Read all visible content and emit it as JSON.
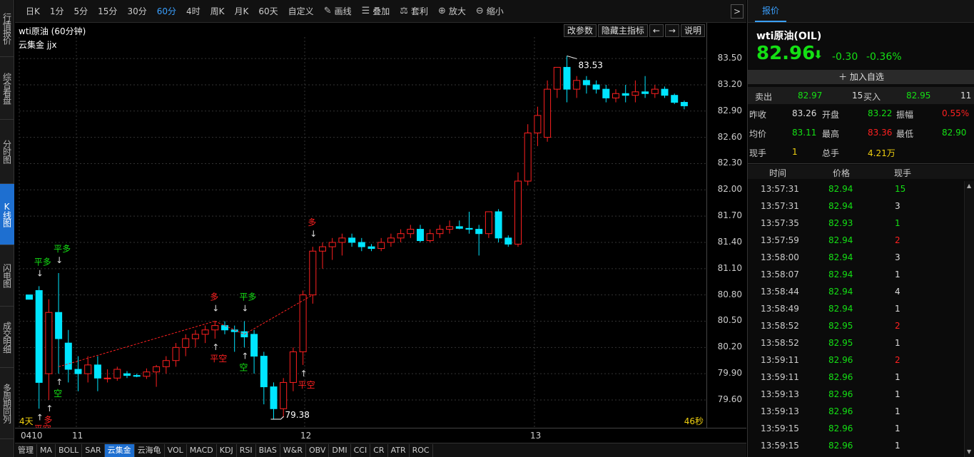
{
  "left_tabs": [
    "行情报价",
    "综合看盘",
    "分时图",
    "K线图",
    "闪电图",
    "成交明细",
    "多周期同列"
  ],
  "toolbar": {
    "periods": [
      "日K",
      "1分",
      "5分",
      "15分",
      "30分",
      "60分",
      "4时",
      "周K",
      "月K",
      "60天",
      "自定义"
    ],
    "active_period": "60分",
    "tools": [
      {
        "icon": "pencil-icon",
        "label": "画线"
      },
      {
        "icon": "layers-icon",
        "label": "叠加"
      },
      {
        "icon": "arbitrage-icon",
        "label": "套利"
      },
      {
        "icon": "zoom-in-icon",
        "label": "放大"
      },
      {
        "icon": "zoom-out-icon",
        "label": "缩小"
      }
    ],
    "expand": ">"
  },
  "chart": {
    "title": "wti原油 (60分钟)",
    "indicator": "云集金 jjx",
    "buttons": [
      "改参数",
      "隐藏主指标",
      "←",
      "→",
      "说明"
    ],
    "days_left": "4天",
    "seconds_left": "46秒",
    "high_label": "83.53",
    "low_label": "79.38",
    "date_labels": [
      "0410",
      "11",
      "12",
      "13"
    ]
  },
  "chart_data": {
    "type": "candlestick",
    "ylim": [
      79.38,
      83.55
    ],
    "y_ticks": [
      "83.50",
      "83.20",
      "82.90",
      "82.60",
      "82.30",
      "82.00",
      "81.70",
      "81.40",
      "81.10",
      "80.80",
      "80.50",
      "80.20",
      "79.90",
      "79.60"
    ],
    "candles": [
      {
        "o": 80.8,
        "h": 80.8,
        "l": 80.75,
        "c": 80.75
      },
      {
        "o": 80.85,
        "h": 80.9,
        "l": 79.5,
        "c": 79.8
      },
      {
        "o": 79.9,
        "h": 80.75,
        "l": 79.6,
        "c": 80.6
      },
      {
        "o": 80.6,
        "h": 81.05,
        "l": 79.9,
        "c": 80.3
      },
      {
        "o": 80.25,
        "h": 80.4,
        "l": 79.8,
        "c": 79.95
      },
      {
        "o": 79.95,
        "h": 80.1,
        "l": 79.7,
        "c": 79.9
      },
      {
        "o": 79.9,
        "h": 80.1,
        "l": 79.8,
        "c": 80.0
      },
      {
        "o": 80.0,
        "h": 80.1,
        "l": 79.7,
        "c": 79.85
      },
      {
        "o": 79.85,
        "h": 79.95,
        "l": 79.8,
        "c": 79.85
      },
      {
        "o": 79.85,
        "h": 79.98,
        "l": 79.82,
        "c": 79.95
      },
      {
        "o": 79.9,
        "h": 79.93,
        "l": 79.85,
        "c": 79.88
      },
      {
        "o": 79.88,
        "h": 79.9,
        "l": 79.86,
        "c": 79.87
      },
      {
        "o": 79.87,
        "h": 79.96,
        "l": 79.84,
        "c": 79.92
      },
      {
        "o": 79.92,
        "h": 80.0,
        "l": 79.75,
        "c": 79.98
      },
      {
        "o": 79.98,
        "h": 80.1,
        "l": 79.9,
        "c": 80.05
      },
      {
        "o": 80.05,
        "h": 80.25,
        "l": 79.98,
        "c": 80.2
      },
      {
        "o": 80.2,
        "h": 80.35,
        "l": 80.1,
        "c": 80.3
      },
      {
        "o": 80.3,
        "h": 80.4,
        "l": 80.2,
        "c": 80.35
      },
      {
        "o": 80.35,
        "h": 80.45,
        "l": 80.25,
        "c": 80.4
      },
      {
        "o": 80.4,
        "h": 80.5,
        "l": 80.3,
        "c": 80.45
      },
      {
        "o": 80.45,
        "h": 80.5,
        "l": 80.35,
        "c": 80.4
      },
      {
        "o": 80.4,
        "h": 80.45,
        "l": 80.15,
        "c": 80.38
      },
      {
        "o": 80.38,
        "h": 80.5,
        "l": 80.2,
        "c": 80.32
      },
      {
        "o": 80.35,
        "h": 80.4,
        "l": 79.9,
        "c": 80.1
      },
      {
        "o": 80.1,
        "h": 80.15,
        "l": 79.55,
        "c": 79.75
      },
      {
        "o": 79.75,
        "h": 79.8,
        "l": 79.38,
        "c": 79.5
      },
      {
        "o": 79.5,
        "h": 79.85,
        "l": 79.4,
        "c": 79.8
      },
      {
        "o": 79.8,
        "h": 80.2,
        "l": 79.7,
        "c": 80.15
      },
      {
        "o": 80.15,
        "h": 80.85,
        "l": 80.0,
        "c": 80.8
      },
      {
        "o": 80.8,
        "h": 81.35,
        "l": 80.7,
        "c": 81.3
      },
      {
        "o": 81.3,
        "h": 81.4,
        "l": 81.1,
        "c": 81.35
      },
      {
        "o": 81.35,
        "h": 81.45,
        "l": 81.2,
        "c": 81.4
      },
      {
        "o": 81.4,
        "h": 81.5,
        "l": 81.25,
        "c": 81.45
      },
      {
        "o": 81.45,
        "h": 81.5,
        "l": 81.35,
        "c": 81.4
      },
      {
        "o": 81.4,
        "h": 81.45,
        "l": 81.3,
        "c": 81.35
      },
      {
        "o": 81.35,
        "h": 81.38,
        "l": 81.3,
        "c": 81.33
      },
      {
        "o": 81.33,
        "h": 81.45,
        "l": 81.3,
        "c": 81.4
      },
      {
        "o": 81.4,
        "h": 81.5,
        "l": 81.35,
        "c": 81.45
      },
      {
        "o": 81.45,
        "h": 81.55,
        "l": 81.4,
        "c": 81.5
      },
      {
        "o": 81.5,
        "h": 81.6,
        "l": 81.45,
        "c": 81.55
      },
      {
        "o": 81.55,
        "h": 81.6,
        "l": 81.4,
        "c": 81.42
      },
      {
        "o": 81.42,
        "h": 81.55,
        "l": 81.4,
        "c": 81.5
      },
      {
        "o": 81.5,
        "h": 81.6,
        "l": 81.45,
        "c": 81.55
      },
      {
        "o": 81.55,
        "h": 81.65,
        "l": 81.5,
        "c": 81.58
      },
      {
        "o": 81.58,
        "h": 81.65,
        "l": 81.55,
        "c": 81.56
      },
      {
        "o": 81.56,
        "h": 81.75,
        "l": 81.5,
        "c": 81.55
      },
      {
        "o": 81.55,
        "h": 81.6,
        "l": 81.25,
        "c": 81.5
      },
      {
        "o": 81.5,
        "h": 81.75,
        "l": 81.45,
        "c": 81.75
      },
      {
        "o": 81.75,
        "h": 81.78,
        "l": 81.4,
        "c": 81.45
      },
      {
        "o": 81.45,
        "h": 81.48,
        "l": 81.35,
        "c": 81.38
      },
      {
        "o": 81.38,
        "h": 82.2,
        "l": 81.35,
        "c": 82.1
      },
      {
        "o": 82.1,
        "h": 82.75,
        "l": 82.05,
        "c": 82.65
      },
      {
        "o": 82.65,
        "h": 82.95,
        "l": 82.5,
        "c": 82.85
      },
      {
        "o": 82.6,
        "h": 83.25,
        "l": 82.55,
        "c": 83.15
      },
      {
        "o": 83.15,
        "h": 83.4,
        "l": 83.05,
        "c": 83.4
      },
      {
        "o": 83.4,
        "h": 83.53,
        "l": 83.0,
        "c": 83.15
      },
      {
        "o": 83.15,
        "h": 83.3,
        "l": 83.05,
        "c": 83.25
      },
      {
        "o": 83.25,
        "h": 83.3,
        "l": 83.1,
        "c": 83.2
      },
      {
        "o": 83.2,
        "h": 83.25,
        "l": 83.1,
        "c": 83.15
      },
      {
        "o": 83.15,
        "h": 83.2,
        "l": 83.0,
        "c": 83.05
      },
      {
        "o": 83.05,
        "h": 83.15,
        "l": 83.0,
        "c": 83.1
      },
      {
        "o": 83.1,
        "h": 83.2,
        "l": 83.0,
        "c": 83.08
      },
      {
        "o": 83.08,
        "h": 83.25,
        "l": 83.0,
        "c": 83.12
      },
      {
        "o": 83.12,
        "h": 83.3,
        "l": 83.05,
        "c": 83.1
      },
      {
        "o": 83.1,
        "h": 83.2,
        "l": 83.05,
        "c": 83.15
      },
      {
        "o": 83.15,
        "h": 83.18,
        "l": 83.05,
        "c": 83.08
      },
      {
        "o": 83.08,
        "h": 83.1,
        "l": 82.98,
        "c": 83.0
      },
      {
        "o": 83.0,
        "h": 83.02,
        "l": 82.92,
        "c": 82.96
      }
    ],
    "signals": [
      {
        "label": "平多",
        "color": "#14e014",
        "candle": 1,
        "pos": "above"
      },
      {
        "label": "平空",
        "color": "#ff2020",
        "candle": 1,
        "pos": "below"
      },
      {
        "label": "空",
        "color": "#14e014",
        "candle": 1,
        "pos": "below2"
      },
      {
        "label": "多",
        "color": "#ff2020",
        "candle": 2,
        "pos": "below"
      },
      {
        "label": "平多",
        "color": "#14e014",
        "candle": 3,
        "pos": "above"
      },
      {
        "label": "空",
        "color": "#14e014",
        "candle": 3,
        "pos": "below"
      },
      {
        "label": "多",
        "color": "#ff2020",
        "candle": 19,
        "pos": "above"
      },
      {
        "label": "平空",
        "color": "#ff2020",
        "candle": 19,
        "pos": "below"
      },
      {
        "label": "平多",
        "color": "#14e014",
        "candle": 22,
        "pos": "above"
      },
      {
        "label": "空",
        "color": "#14e014",
        "candle": 22,
        "pos": "below"
      },
      {
        "label": "平空",
        "color": "#ff2020",
        "candle": 28,
        "pos": "below"
      },
      {
        "label": "多",
        "color": "#ff2020",
        "candle": 29,
        "pos": "above"
      }
    ]
  },
  "bottom_tabs": [
    "管理",
    "MA",
    "BOLL",
    "SAR",
    "云集金",
    "云海龟",
    "VOL",
    "MACD",
    "KDJ",
    "RSI",
    "BIAS",
    "W&R",
    "OBV",
    "DMI",
    "CCI",
    "CR",
    "ATR",
    "ROC"
  ],
  "active_bottom_tab": "云集金",
  "quote": {
    "tab": "报价",
    "name": "wti原油(OIL)",
    "price": "82.96",
    "change": "-0.30",
    "pct": "-0.36%",
    "add_watch": "加入自选",
    "sell_label": "卖出",
    "sell_price": "82.97",
    "sell_vol": "15",
    "buy_label": "买入",
    "buy_price": "82.95",
    "buy_vol": "11",
    "stats": [
      {
        "label": "昨收",
        "value": "83.26",
        "color": "#ddd"
      },
      {
        "label": "开盘",
        "value": "83.22",
        "color": "#14e014"
      },
      {
        "label": "振幅",
        "value": "0.55%",
        "color": "#ff2020"
      },
      {
        "label": "均价",
        "value": "83.11",
        "color": "#14e014"
      },
      {
        "label": "最高",
        "value": "83.36",
        "color": "#ff2020"
      },
      {
        "label": "最低",
        "value": "82.90",
        "color": "#14e014"
      },
      {
        "label": "现手",
        "value": "1",
        "color": "#f0d010"
      },
      {
        "label": "总手",
        "value": "4.21万",
        "color": "#f0d010"
      }
    ],
    "tick_headers": [
      "时间",
      "价格",
      "现手"
    ],
    "ticks": [
      {
        "time": "13:57:31",
        "price": "82.94",
        "vol": "15",
        "vcolor": "#14e014"
      },
      {
        "time": "13:57:31",
        "price": "82.94",
        "vol": "3",
        "vcolor": "#ddd"
      },
      {
        "time": "13:57:35",
        "price": "82.93",
        "vol": "1",
        "vcolor": "#14e014"
      },
      {
        "time": "13:57:59",
        "price": "82.94",
        "vol": "2",
        "vcolor": "#ff2020"
      },
      {
        "time": "13:58:00",
        "price": "82.94",
        "vol": "3",
        "vcolor": "#ddd"
      },
      {
        "time": "13:58:07",
        "price": "82.94",
        "vol": "1",
        "vcolor": "#ddd"
      },
      {
        "time": "13:58:44",
        "price": "82.94",
        "vol": "4",
        "vcolor": "#ddd"
      },
      {
        "time": "13:58:49",
        "price": "82.94",
        "vol": "1",
        "vcolor": "#ddd"
      },
      {
        "time": "13:58:52",
        "price": "82.95",
        "vol": "2",
        "vcolor": "#ff2020"
      },
      {
        "time": "13:58:52",
        "price": "82.95",
        "vol": "1",
        "vcolor": "#ddd"
      },
      {
        "time": "13:59:11",
        "price": "82.96",
        "vol": "2",
        "vcolor": "#ff2020"
      },
      {
        "time": "13:59:11",
        "price": "82.96",
        "vol": "1",
        "vcolor": "#ddd"
      },
      {
        "time": "13:59:13",
        "price": "82.96",
        "vol": "1",
        "vcolor": "#ddd"
      },
      {
        "time": "13:59:13",
        "price": "82.96",
        "vol": "1",
        "vcolor": "#ddd"
      },
      {
        "time": "13:59:15",
        "price": "82.96",
        "vol": "1",
        "vcolor": "#ddd"
      },
      {
        "time": "13:59:15",
        "price": "82.96",
        "vol": "1",
        "vcolor": "#ddd"
      }
    ]
  },
  "colors": {
    "up": "#ff2020",
    "down": "#00e5ff",
    "accent": "#1e6fd0",
    "green": "#14e014"
  }
}
